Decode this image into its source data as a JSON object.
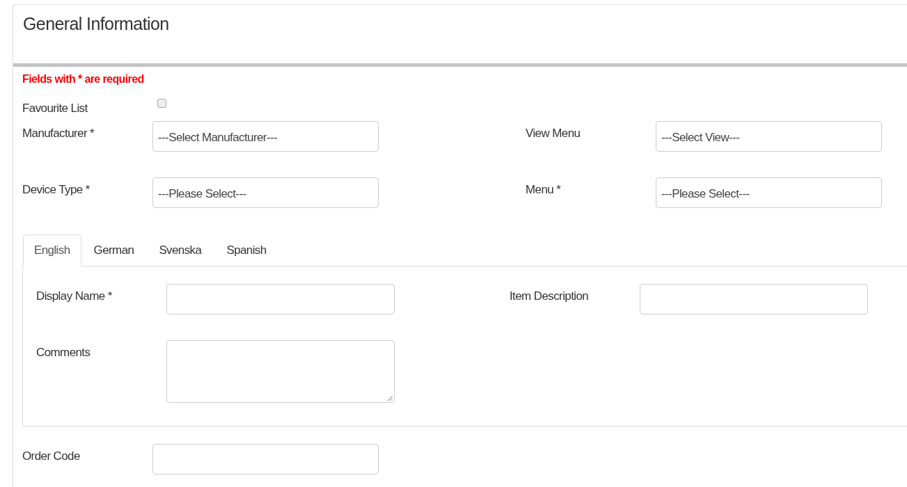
{
  "panel": {
    "title": "General Information",
    "required_note": "Fields with * are required"
  },
  "favourite": {
    "label": "Favourite List",
    "checked": false
  },
  "rows": [
    [
      {
        "label": "Manufacturer *",
        "kind": "select",
        "value": "---Select Manufacturer---"
      },
      {
        "label": "View Menu",
        "kind": "select",
        "value": "---Select View---"
      }
    ],
    [
      {
        "label": "Device Type *",
        "kind": "select",
        "value": "---Please Select---"
      },
      {
        "label": "Menu *",
        "kind": "select",
        "value": "---Please Select---"
      }
    ]
  ],
  "tabs": [
    {
      "label": "English",
      "selected": true
    },
    {
      "label": "German",
      "selected": false
    },
    {
      "label": "Svenska",
      "selected": false
    },
    {
      "label": "Spanish",
      "selected": false
    }
  ],
  "tab_rows": [
    [
      {
        "label": "Display Name *",
        "kind": "text"
      },
      {
        "label": "Item Description",
        "kind": "text"
      }
    ],
    [
      {
        "label": "Comments",
        "kind": "textarea"
      }
    ]
  ],
  "bottom_rows": [
    [
      {
        "label": "Order Code",
        "kind": "text"
      }
    ]
  ]
}
